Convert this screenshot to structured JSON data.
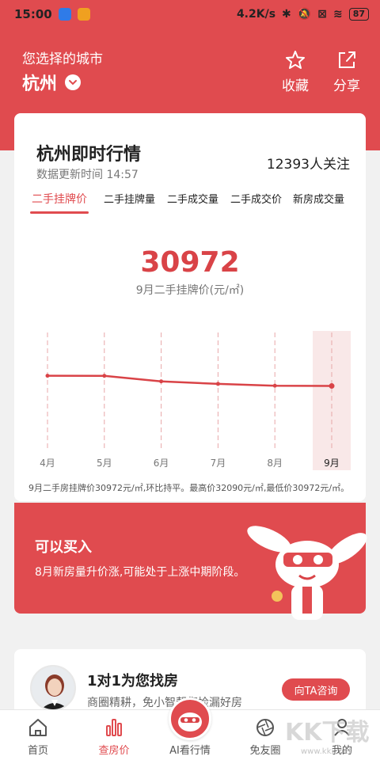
{
  "status_bar": {
    "time": "15:00",
    "network_speed": "4.2K/s",
    "battery": "87"
  },
  "header": {
    "city_label": "您选择的城市",
    "city_name": "杭州",
    "favorite_label": "收藏",
    "share_label": "分享",
    "accent_color": "#e04b4f"
  },
  "market_card": {
    "title": "杭州即时行情",
    "updated": "数据更新时间 14:57",
    "followers": "12393人关注",
    "tabs": [
      {
        "label": "二手挂牌价",
        "active": true
      },
      {
        "label": "二手挂牌量",
        "active": false
      },
      {
        "label": "二手成交量",
        "active": false
      },
      {
        "label": "二手成交价",
        "active": false
      },
      {
        "label": "新房成交量",
        "active": false
      }
    ],
    "big_value": "30972",
    "big_label": "9月二手挂牌价(元/㎡)",
    "note": "9月二手房挂牌价30972元/㎡,环比持平。最高价32090元/㎡,最低价30972元/㎡。"
  },
  "chart_data": {
    "type": "line",
    "categories": [
      "4月",
      "5月",
      "6月",
      "7月",
      "8月",
      "9月"
    ],
    "series": [
      {
        "values": [
          32090,
          32080,
          31480,
          31200,
          31000,
          30972
        ]
      }
    ],
    "highlight_category": "9月",
    "ylim": [
      24000,
      37000
    ],
    "grid": false,
    "line_color": "#d94347"
  },
  "advice": {
    "title": "可以买入",
    "text": "8月新房量升价涨,可能处于上涨中期阶段。"
  },
  "agent_card": {
    "title": "1对1为您找房",
    "subtitle": "商圈精耕，免小智帮您捡漏好房",
    "button": "向TA咨询"
  },
  "tab_bar": {
    "items": [
      {
        "label": "首页",
        "icon": "home-icon",
        "active": false
      },
      {
        "label": "查房价",
        "icon": "bar-chart-icon",
        "active": true
      },
      {
        "label": "AI看行情",
        "icon": "mascot-icon",
        "active": false
      },
      {
        "label": "免友圈",
        "icon": "camera-shutter-icon",
        "active": false
      },
      {
        "label": "我的",
        "icon": "user-icon",
        "active": false
      }
    ]
  },
  "watermark": {
    "text": "KK下载",
    "url": "www.kkx.net"
  }
}
